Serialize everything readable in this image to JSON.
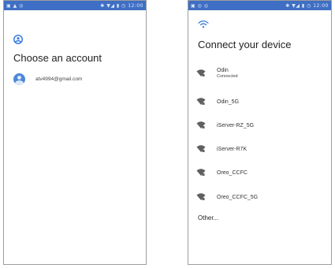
{
  "left_screen": {
    "status_bar": {
      "left": "▣ ▲ ◎",
      "right": "✱ ▼◢ ▮ ◷ 12:00"
    },
    "icon": "account-circle-icon",
    "title": "Choose an account",
    "account": {
      "email": "atv4994@gmail.com",
      "icon": "avatar-icon"
    }
  },
  "right_screen": {
    "status_bar": {
      "left": "▣ ◎ ◎",
      "right": "✱ ▼◢ ▮ ◷ 12:00"
    },
    "icon": "wifi-icon",
    "title": "Connect your device",
    "networks": [
      {
        "name": "Odin",
        "status": "Connected"
      },
      {
        "name": "Odin_5G",
        "status": ""
      },
      {
        "name": "iServer-RZ_5G",
        "status": ""
      },
      {
        "name": "iServer-R7K",
        "status": ""
      },
      {
        "name": "Oreo_CCFC",
        "status": ""
      },
      {
        "name": "Oreo_CCFC_5G",
        "status": ""
      }
    ],
    "other_label": "Other..."
  },
  "colors": {
    "status_bar": "#3f6fc4",
    "accent": "#3b7be0",
    "wifi_icon": "#606060"
  }
}
